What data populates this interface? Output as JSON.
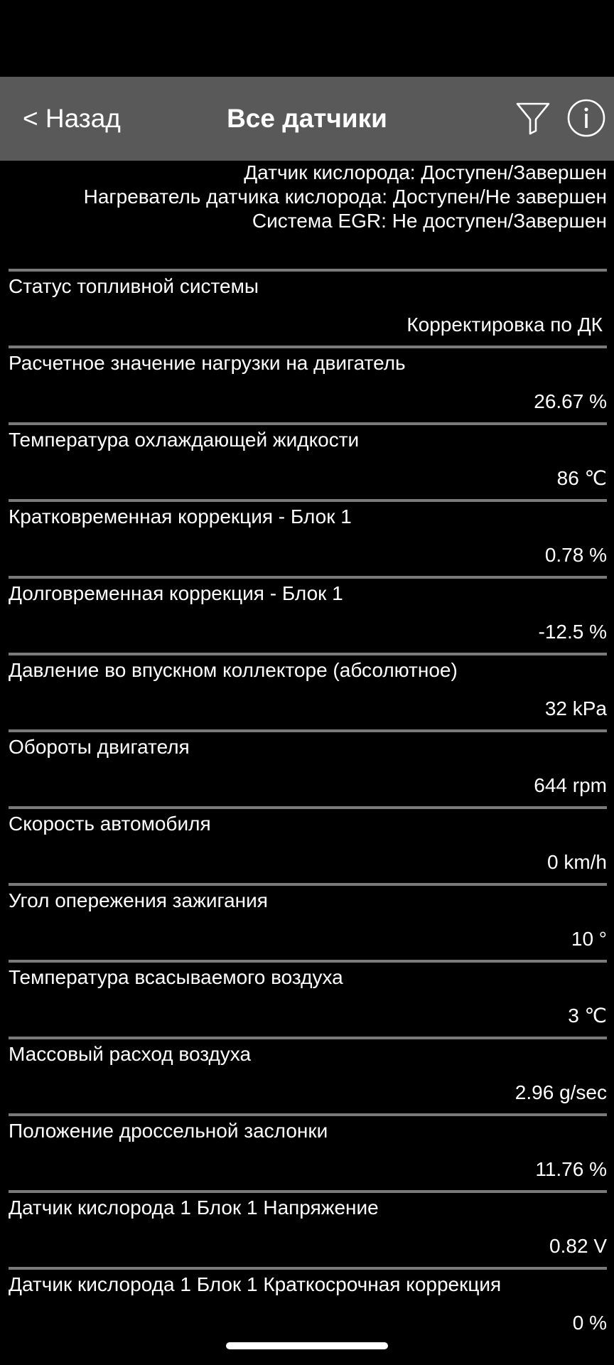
{
  "app_bar": {
    "back_label": "< Назад",
    "title": "Все датчики",
    "filter_icon": "filter-icon",
    "info_icon": "info-icon"
  },
  "monitor_status": {
    "lines": [
      "Датчик кислорода: Доступен/Завершен",
      "Нагреватель датчика кислорода: Доступен/Не завершен",
      "Система EGR: Не доступен/Завершен"
    ]
  },
  "sensors": [
    {
      "name": "Статус топливной системы",
      "value": "Корректировка по ДК"
    },
    {
      "name": "Расчетное значение нагрузки на двигатель",
      "value": "26.67 %"
    },
    {
      "name": "Температура охлаждающей жидкости",
      "value": "86 ℃"
    },
    {
      "name": "Кратковременная коррекция - Блок 1",
      "value": "0.78 %"
    },
    {
      "name": "Долговременная коррекция - Блок 1",
      "value": "-12.5 %"
    },
    {
      "name": "Давление во впускном коллекторе (абсолютное)",
      "value": "32 kPa"
    },
    {
      "name": "Обороты двигателя",
      "value": "644 rpm"
    },
    {
      "name": "Скорость автомобиля",
      "value": "0 km/h"
    },
    {
      "name": "Угол опережения зажигания",
      "value": "10 °"
    },
    {
      "name": "Температура всасываемого воздуха",
      "value": "3 ℃"
    },
    {
      "name": "Массовый расход воздуха",
      "value": "2.96 g/sec"
    },
    {
      "name": "Положение дроссельной заслонки",
      "value": "11.76 %"
    },
    {
      "name": "Датчик кислорода 1 Блок 1 Напряжение",
      "value": "0.82 V"
    },
    {
      "name": "Датчик кислорода 1 Блок 1 Краткосрочная коррекция",
      "value": "0 %"
    }
  ],
  "colors": {
    "background": "#000000",
    "app_bar": "#595959",
    "divider": "#7a7a7a",
    "text": "#ffffff"
  }
}
